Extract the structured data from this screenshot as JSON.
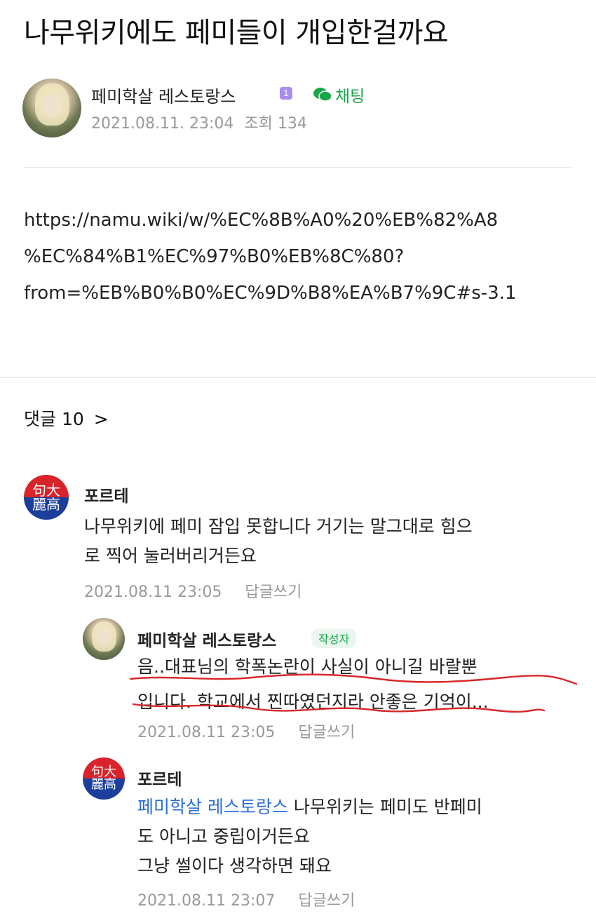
{
  "post": {
    "title": "나무위키에도 페미들이 개입한걸까요",
    "author": "페미학살 레스토랑스",
    "level": "1",
    "chat_label": "채팅",
    "date": "2021.08.11. 23:04",
    "views_label": "조회 134",
    "body_lines": [
      "https://namu.wiki/w/%EC%8B%A0%20%EB%82%A8",
      "%EC%84%B1%EC%97%B0%EB%8C%80?",
      "from=%EB%B0%B0%EC%9D%B8%EA%B7%9C#s-3.1"
    ]
  },
  "comments_header": {
    "label": "댓글 10",
    "chevron": ">"
  },
  "comments": [
    {
      "author": "포르테",
      "avatar_text": [
        "句大",
        "麗高"
      ],
      "lines": [
        "나무위키에 페미 잠입 못합니다 거기는 말그대로 힘으",
        "로 찍어 눌러버리거든요"
      ],
      "date": "2021.08.11 23:05",
      "reply_label": "답글쓰기"
    },
    {
      "author": "페미학살 레스토랑스",
      "author_tag": "작성자",
      "lines": [
        "음..대표님의 학폭논란이 사실이 아니길 바랄뿐",
        "입니다. 학교에서 찐따였던지라 안좋은 기억이..."
      ],
      "date": "2021.08.11 23:05",
      "reply_label": "답글쓰기"
    },
    {
      "author": "포르테",
      "avatar_text": [
        "句大",
        "麗高"
      ],
      "mention": "페미학살 레스토랑스",
      "lines": [
        " 나무위키는 페미도 반페미",
        "도 아니고 중립이거든요",
        "그냥 썰이다 생각하면 돼요"
      ],
      "date": "2021.08.11 23:07",
      "reply_label": "답글쓰기"
    }
  ],
  "colors": {
    "accent_green": "#1aa64a",
    "mention_blue": "#2b6fd6",
    "level_purple": "#a98cf0",
    "scribble_red": "#d8282a"
  }
}
